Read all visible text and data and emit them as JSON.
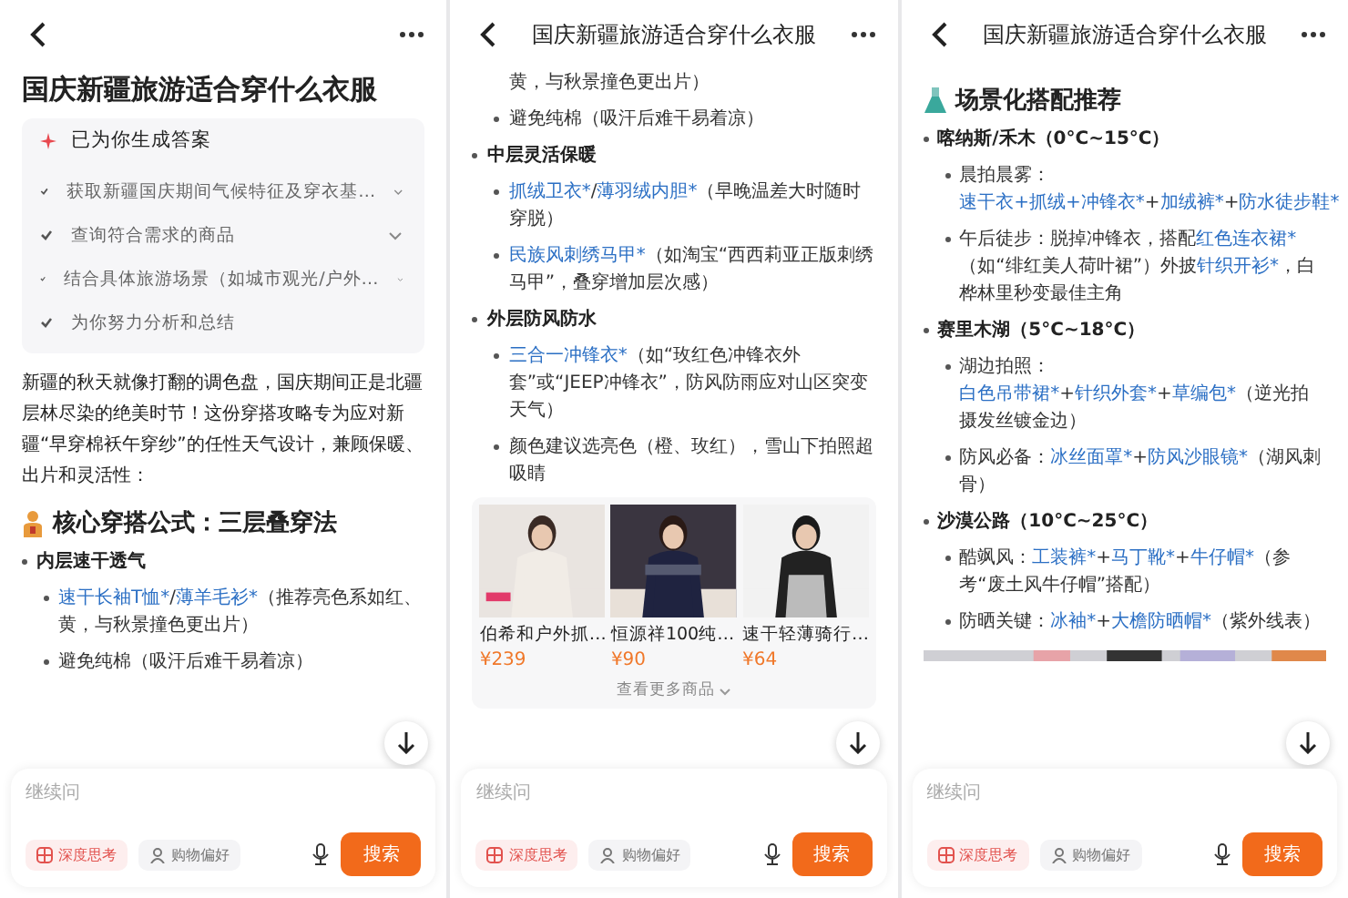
{
  "panels": [
    {
      "blocks": [
        {
          "kind": "title",
          "text": "国庆新疆旅游适合穿什么衣服"
        },
        {
          "kind": "steps",
          "label": "已为你生成答案",
          "steps": [
            {
              "text": "获取新疆国庆期间气候特征及穿衣基…",
              "expandable": true
            },
            {
              "text": "查询符合需求的商品",
              "expandable": true
            },
            {
              "text": "结合具体旅游场景（如城市观光/户外…",
              "expandable": true
            },
            {
              "text": "为你努力分析和总结",
              "expandable": false
            }
          ]
        },
        {
          "kind": "paragraph",
          "text": "新疆的秋天就像打翻的调色盘，国庆期间正是北疆层林尽染的绝美时节！这份穿搭攻略专为应对新疆“早穿棉袄午穿纱”的任性天气设计，兼顾保暖、出片和灵活性："
        },
        {
          "kind": "heading",
          "text": "核心穿搭公式：三层叠穿法"
        },
        {
          "kind": "bullet",
          "text": "内层速干透气"
        },
        {
          "kind": "sub",
          "parts": [
            {
              "text": "速干长袖T恤*",
              "link": true
            },
            {
              "text": "/",
              "link": false
            },
            {
              "text": "薄羊毛衫*",
              "link": true
            },
            {
              "text": "（推荐亮色系如红、黄，与秋景撞色更出片）",
              "link": false
            }
          ]
        },
        {
          "kind": "sub",
          "parts": [
            {
              "text": "避免纯棉（吸汗后难干易着凉）",
              "link": false
            }
          ]
        }
      ],
      "composer": {
        "placeholder": "继续问",
        "chips": [
          {
            "label": "深度思考",
            "selected": true
          },
          {
            "label": "购物偏好",
            "selected": false
          }
        ],
        "send": "搜索"
      }
    },
    {
      "header": {
        "title": "国庆新疆旅游适合穿什么衣服"
      },
      "blocks": [
        {
          "kind": "continuation",
          "text": "黄，与秋景撞色更出片）"
        },
        {
          "kind": "sub",
          "parts": [
            {
              "text": "避免纯棉（吸汗后难干易着凉）",
              "link": false
            }
          ]
        },
        {
          "kind": "bullet",
          "text": "中层灵活保暖"
        },
        {
          "kind": "sub",
          "parts": [
            {
              "text": "抓绒卫衣*",
              "link": true
            },
            {
              "text": "/",
              "link": false
            },
            {
              "text": "薄羽绒内胆*",
              "link": true
            },
            {
              "text": "（早晚温差大时随时穿脱）",
              "link": false
            }
          ]
        },
        {
          "kind": "sub",
          "parts": [
            {
              "text": "民族风刺绣马甲*",
              "link": true
            },
            {
              "text": "（如淘宝“西西莉亚正版刺绣马甲”，叠穿增加层次感）",
              "link": false
            }
          ]
        },
        {
          "kind": "bullet",
          "text": "外层防风防水"
        },
        {
          "kind": "sub",
          "parts": [
            {
              "text": "三合一冲锋衣*",
              "link": true
            },
            {
              "text": "（如“玫红色冲锋衣外套”或“JEEP冲锋衣”，防风防雨应对山区突变天气）",
              "link": false
            }
          ]
        },
        {
          "kind": "sub",
          "parts": [
            {
              "text": "颜色建议选亮色（橙、玫红），雪山下拍照超吸睛",
              "link": false
            }
          ]
        },
        {
          "kind": "products",
          "items": [
            {
              "name": "伯希和户外抓…",
              "price": "¥239"
            },
            {
              "name": "恒源祥100纯…",
              "price": "¥90"
            },
            {
              "name": "速干轻薄骑行…",
              "price": "¥64"
            }
          ],
          "more": "查看更多商品"
        }
      ],
      "composer": {
        "placeholder": "继续问",
        "chips": [
          {
            "label": "深度思考",
            "selected": true
          },
          {
            "label": "购物偏好",
            "selected": false
          }
        ],
        "send": "搜索"
      }
    },
    {
      "header": {
        "title": "国庆新疆旅游适合穿什么衣服"
      },
      "blocks": [
        {
          "kind": "heading",
          "text": "场景化搭配推荐"
        },
        {
          "kind": "bullet",
          "text": "喀纳斯/禾木（0°C~15°C）"
        },
        {
          "kind": "sub",
          "parts": [
            {
              "text": "晨拍晨雾：",
              "link": false
            },
            {
              "text": "速干衣+抓绒+冲锋衣*",
              "link": true
            },
            {
              "text": "+",
              "link": false
            },
            {
              "text": "加绒裤*",
              "link": true
            },
            {
              "text": "+",
              "link": false
            },
            {
              "text": "防水徒步鞋*",
              "link": true
            }
          ]
        },
        {
          "kind": "sub",
          "parts": [
            {
              "text": "午后徒步：脱掉冲锋衣，搭配",
              "link": false
            },
            {
              "text": "红色连衣裙*",
              "link": true
            },
            {
              "text": "（如“绯红美人荷叶裙”）外披",
              "link": false
            },
            {
              "text": "针织开衫*",
              "link": true
            },
            {
              "text": "，白桦林里秒变最佳主角",
              "link": false
            }
          ]
        },
        {
          "kind": "bullet",
          "text": "赛里木湖（5°C~18°C）"
        },
        {
          "kind": "sub",
          "parts": [
            {
              "text": "湖边拍照：",
              "link": false
            },
            {
              "text": "白色吊带裙*",
              "link": true
            },
            {
              "text": "+",
              "link": false
            },
            {
              "text": "针织外套*",
              "link": true
            },
            {
              "text": "+",
              "link": false
            },
            {
              "text": "草编包*",
              "link": true
            },
            {
              "text": "（逆光拍摄发丝镀金边）",
              "link": false
            }
          ]
        },
        {
          "kind": "sub",
          "parts": [
            {
              "text": "防风必备：",
              "link": false
            },
            {
              "text": "冰丝面罩*",
              "link": true
            },
            {
              "text": "+",
              "link": false
            },
            {
              "text": "防风沙眼镜*",
              "link": true
            },
            {
              "text": "（湖风刺骨）",
              "link": false
            }
          ]
        },
        {
          "kind": "bullet",
          "text": "沙漠公路（10°C~25°C）"
        },
        {
          "kind": "sub",
          "parts": [
            {
              "text": "酷飒风：",
              "link": false
            },
            {
              "text": "工装裤*",
              "link": true
            },
            {
              "text": "+",
              "link": false
            },
            {
              "text": "马丁靴*",
              "link": true
            },
            {
              "text": "+",
              "link": false
            },
            {
              "text": "牛仔帽*",
              "link": true
            },
            {
              "text": "（参考“废土风牛仔帽”搭配）",
              "link": false
            }
          ]
        },
        {
          "kind": "sub",
          "parts": [
            {
              "text": "防晒关键：",
              "link": false
            },
            {
              "text": "冰袖*",
              "link": true
            },
            {
              "text": "+",
              "link": false
            },
            {
              "text": "大檐防晒帽*",
              "link": true
            },
            {
              "text": "（紫外线",
              "link": false
            },
            {
              "text": "表）",
              "link": false
            }
          ]
        },
        {
          "kind": "strip"
        }
      ],
      "composer": {
        "placeholder": "继续问",
        "chips": [
          {
            "label": "深度思考",
            "selected": true
          },
          {
            "label": "购物偏好",
            "selected": false
          }
        ],
        "send": "搜索"
      }
    }
  ]
}
